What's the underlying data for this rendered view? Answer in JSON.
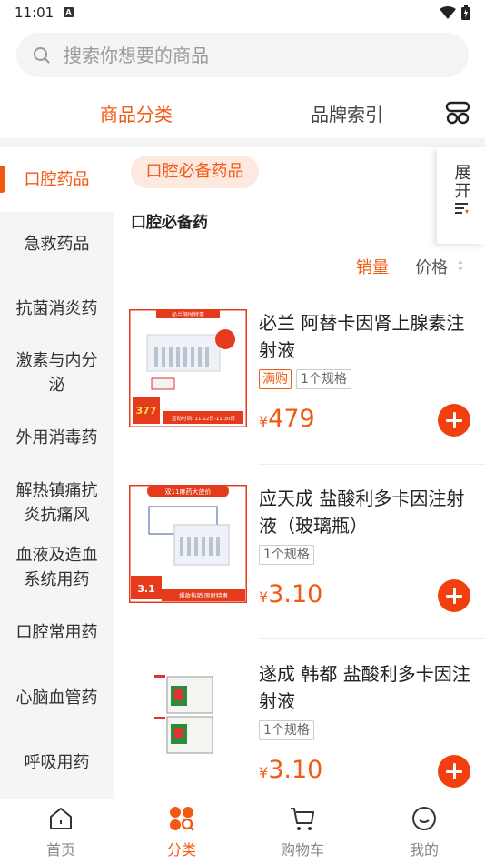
{
  "status_bar": {
    "time": "11:01",
    "notification_icon": "A"
  },
  "search": {
    "placeholder": "搜索你想要的商品"
  },
  "top_tabs": [
    {
      "label": "商品分类",
      "active": true
    },
    {
      "label": "品牌索引",
      "active": false
    }
  ],
  "sidebar": {
    "items": [
      {
        "label": "口腔药品",
        "active": true
      },
      {
        "label": "急救药品"
      },
      {
        "label": "抗菌消炎药"
      },
      {
        "label": "激素与内分泌"
      },
      {
        "label": "外用消毒药"
      },
      {
        "label": "解热镇痛抗炎抗痛风"
      },
      {
        "label": "血液及造血系统用药"
      },
      {
        "label": "口腔常用药"
      },
      {
        "label": "心脑血管药"
      },
      {
        "label": "呼吸用药"
      }
    ]
  },
  "content": {
    "sub_category_tag": "口腔必备药品",
    "section_title": "口腔必备药",
    "expand_label": "展开",
    "sort": {
      "sales": "销量",
      "price": "价格"
    },
    "currency_symbol": "¥",
    "products": [
      {
        "name": "必兰 阿替卡因肾上腺素注射液",
        "promo_badge": "满购",
        "spec_badge": "1个规格",
        "price": "479",
        "thumb_banner": "必兰限时特惠",
        "thumb_footer": "活动时间: 11.12日-11.30日",
        "thumb_price": "377"
      },
      {
        "name": "应天成 盐酸利多卡因注射液（玻璃瓶）",
        "spec_badge": "1个规格",
        "price": "3.10",
        "thumb_banner": "双11麻药大放价",
        "thumb_footer": "爆款热销 限时特惠",
        "thumb_price": "3.1"
      },
      {
        "name": "遂成 韩都 盐酸利多卡因注射液",
        "spec_badge": "1个规格",
        "price": "3.10"
      }
    ]
  },
  "bottom_nav": [
    {
      "label": "首页",
      "icon": "home-icon"
    },
    {
      "label": "分类",
      "icon": "category-icon",
      "active": true
    },
    {
      "label": "购物车",
      "icon": "cart-icon"
    },
    {
      "label": "我的",
      "icon": "profile-icon"
    }
  ],
  "colors": {
    "accent": "#f25a14",
    "add_button": "#f23f0f",
    "sidebar_bg": "#f5f5f5"
  }
}
